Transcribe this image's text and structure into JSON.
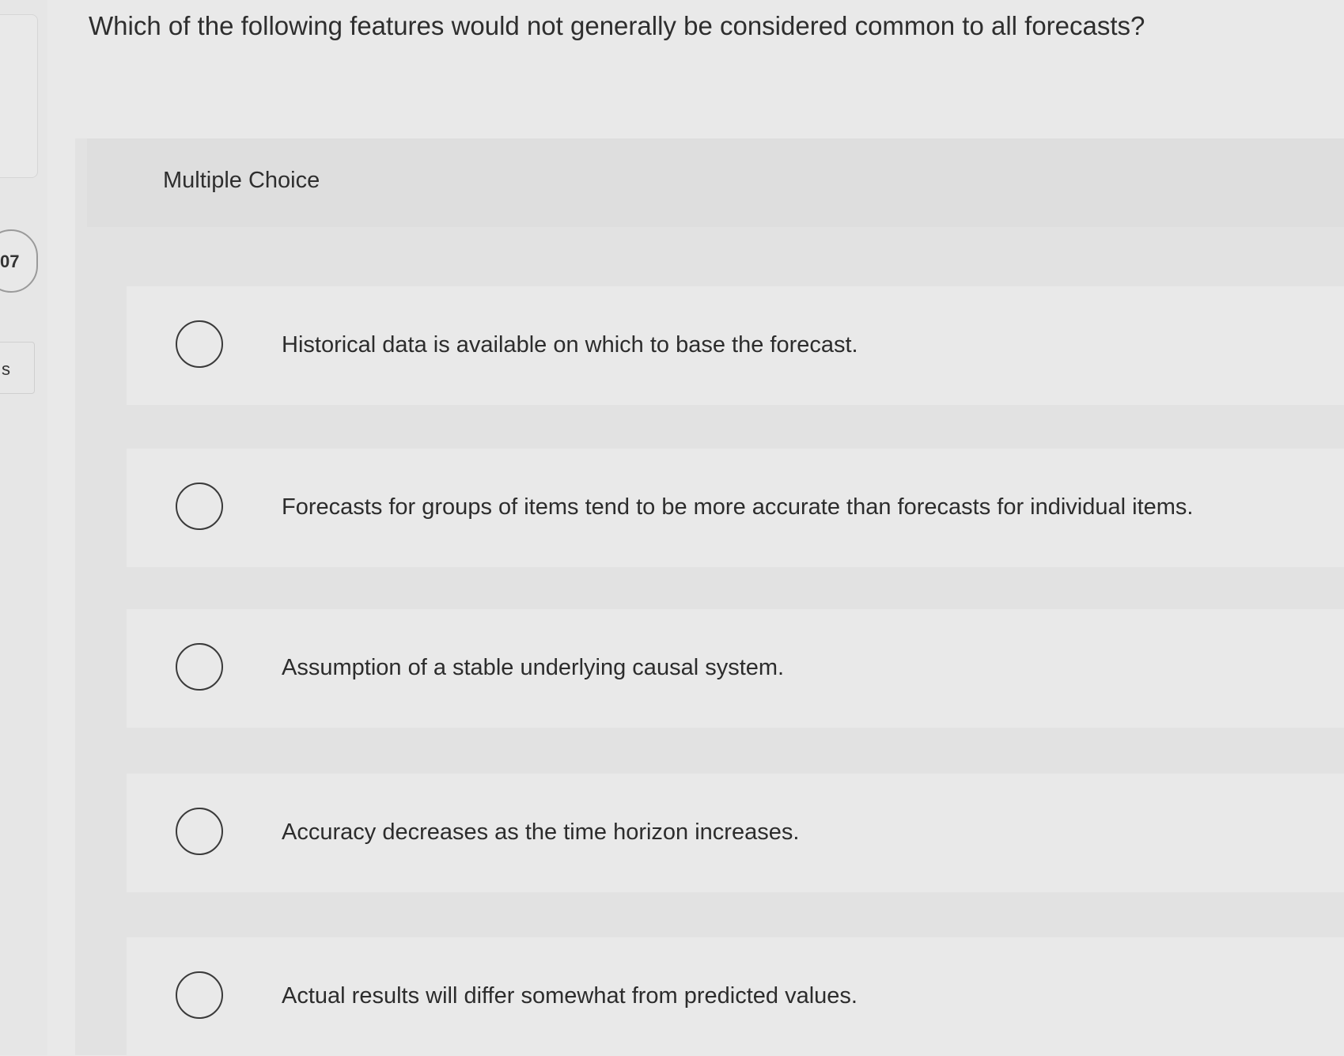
{
  "question": {
    "text": "Which of the following features would not generally be considered common to all forecasts?"
  },
  "question_type": "Multiple Choice",
  "left_rail": {
    "pill_text": "07",
    "tag_text": "s"
  },
  "options": [
    {
      "label": "Historical data is available on which to base the forecast."
    },
    {
      "label": "Forecasts for groups of items tend to be more accurate than forecasts for individual items."
    },
    {
      "label": "Assumption of a stable underlying causal system."
    },
    {
      "label": "Accuracy decreases as the time horizon increases."
    },
    {
      "label": "Actual results will differ somewhat from predicted values."
    }
  ]
}
